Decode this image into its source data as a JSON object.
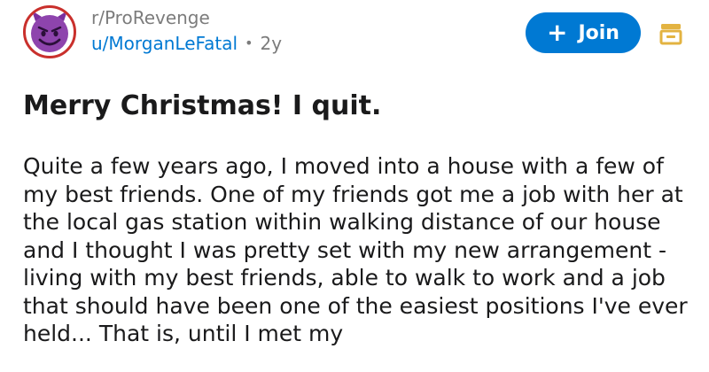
{
  "post": {
    "subreddit": "r/ProRevenge",
    "username": "u/MorganLeFatal",
    "separator": "•",
    "age": "2y",
    "title": "Merry Christmas! I quit.",
    "body": "Quite a few years ago, I moved into a house with a few of my best friends. One of my friends got me a job with her at the local gas station within walking distance of our house and I thought I was pretty set with my new arrangement - living with my best friends, able to walk to work and a job that should have been one of the easiest positions I've ever held... That is, until I met my"
  },
  "join_button": {
    "label": "Join",
    "plus": "+",
    "color": "#0079d3"
  },
  "icons": {
    "avatar": "devil-emoji-icon",
    "menu": "menu-icon"
  },
  "colors": {
    "link": "#0079d3",
    "muted": "#7c7c7c",
    "avatar_ring": "#c9302c",
    "avatar_face": "#8e44ad",
    "menu_icon": "#e3b341"
  }
}
